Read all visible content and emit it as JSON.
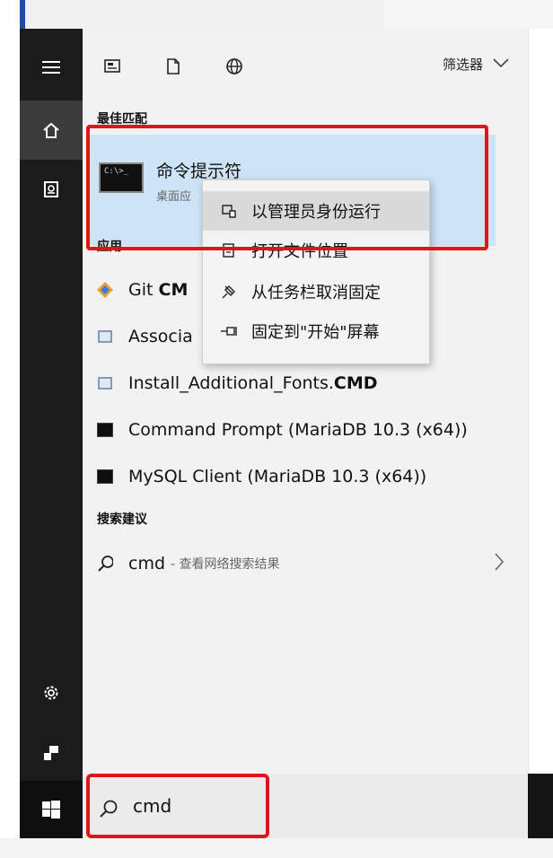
{
  "toolbar": {
    "icons": [
      "apps-icon",
      "document-icon",
      "web-icon"
    ],
    "filter_label": "筛选器"
  },
  "sections": {
    "best_match": "最佳匹配",
    "apps": "应用",
    "suggestions": "搜索建议"
  },
  "best_match": {
    "title": "命令提示符",
    "subtitle": "桌面应",
    "icon_text": "C:\\>_"
  },
  "apps": [
    {
      "prefix": "Git ",
      "bold": "CM",
      "suffix": "",
      "icon": "git-icon"
    },
    {
      "prefix": "Associa",
      "bold": "",
      "suffix": "",
      "icon": "file-icon"
    },
    {
      "prefix": "Install_Additional_Fonts.",
      "bold": "CMD",
      "suffix": "",
      "icon": "file-icon"
    },
    {
      "prefix": "Command Prompt (MariaDB 10.3 (x64))",
      "bold": "",
      "suffix": "",
      "icon": "console-icon"
    },
    {
      "prefix": "MySQL Client (MariaDB 10.3 (x64))",
      "bold": "",
      "suffix": "",
      "icon": "console-icon"
    }
  ],
  "suggestion": {
    "query": "cmd",
    "hint": "- 查看网络搜索结果"
  },
  "context_menu": [
    {
      "label": "以管理员身份运行",
      "icon": "shield-icon"
    },
    {
      "label": "打开文件位置",
      "icon": "folder-icon"
    },
    {
      "label": "从任务栏取消固定",
      "icon": "unpin-icon"
    },
    {
      "label": "固定到\"开始\"屏幕",
      "icon": "pin-icon"
    }
  ],
  "search": {
    "value": "cmd"
  },
  "colors": {
    "rail": "#1b1b1b",
    "highlight": "#e01616",
    "selected": "#cfe3f6"
  }
}
